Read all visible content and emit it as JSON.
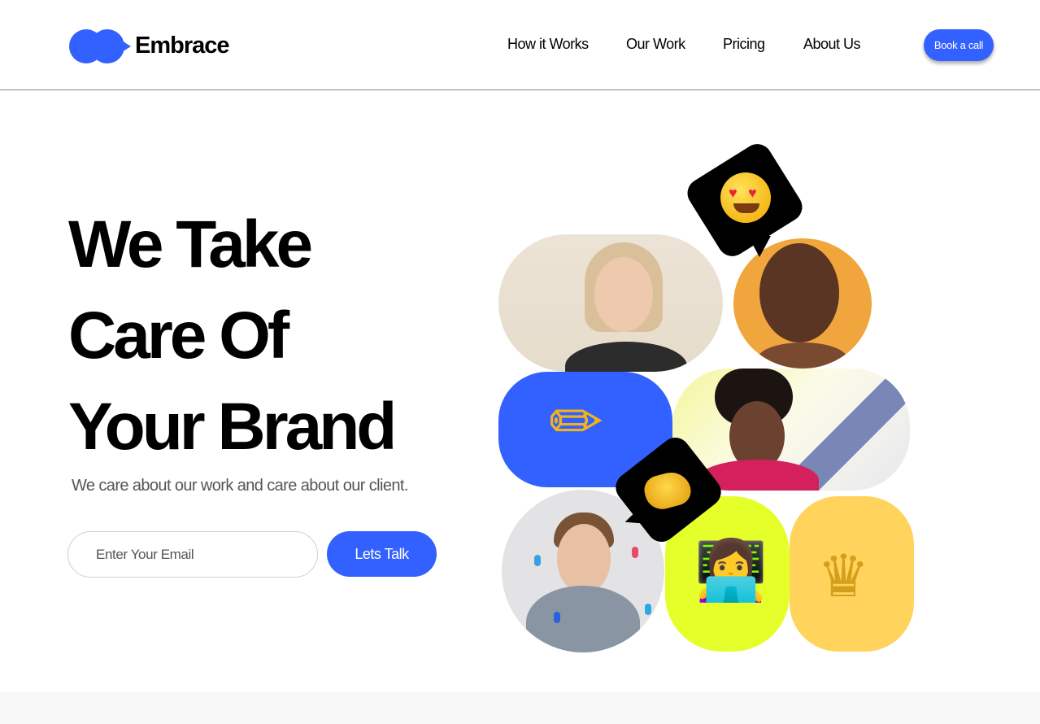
{
  "brand": {
    "name": "Embrace",
    "accent": "#3361ff"
  },
  "nav": {
    "items": [
      "How it Works",
      "Our Work",
      "Pricing",
      "About Us"
    ],
    "cta": "Book a call"
  },
  "hero": {
    "headline": [
      "We Take",
      "Care Of",
      "Your Brand"
    ],
    "subtitle": "We care about our work and care about our client.",
    "email_placeholder": "Enter Your Email",
    "submit_label": "Lets Talk"
  },
  "collage": {
    "tiles": [
      {
        "kind": "photo",
        "subject": "smiling blonde woman",
        "bg": "#ece3d6"
      },
      {
        "kind": "photo",
        "subject": "laughing woman",
        "bg": "#f0a63c"
      },
      {
        "kind": "emoji",
        "icon": "pencil-icon",
        "glyph": "✏",
        "bg": "#3361ff"
      },
      {
        "kind": "photo",
        "subject": "laughing woman with curly hair",
        "bg": "#f4f79a"
      },
      {
        "kind": "photo",
        "subject": "young man with confetti",
        "bg": "#e3e3e6"
      },
      {
        "kind": "emoji",
        "icon": "woman-with-laptop-icon",
        "glyph": "👩‍💻",
        "bg": "#e5ff2a"
      },
      {
        "kind": "emoji",
        "icon": "crown-icon",
        "glyph": "♛",
        "bg": "#ffd35c"
      }
    ],
    "bubbles": [
      {
        "icon": "heart-eyes-emoji-icon"
      },
      {
        "icon": "pinched-fingers-emoji-icon"
      }
    ]
  }
}
